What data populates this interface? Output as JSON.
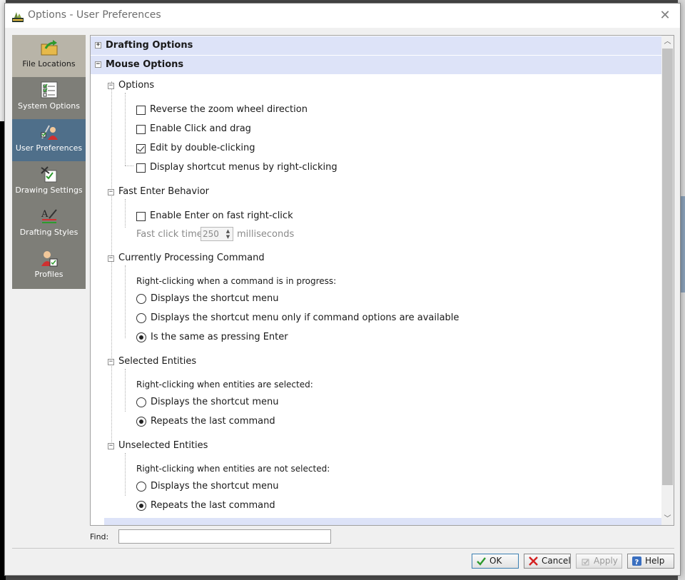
{
  "window": {
    "title": "Options - User Preferences",
    "close_glyph": "✕"
  },
  "nav": {
    "items": [
      {
        "label": "File Locations",
        "icon": "folder-arrow-icon"
      },
      {
        "label": "System Options",
        "icon": "checklist-icon"
      },
      {
        "label": "User Preferences",
        "icon": "user-preferences-icon"
      },
      {
        "label": "Drawing Settings",
        "icon": "drawing-settings-icon"
      },
      {
        "label": "Drafting Styles",
        "icon": "drafting-styles-icon"
      },
      {
        "label": "Profiles",
        "icon": "profiles-icon"
      }
    ],
    "selected": "User Preferences"
  },
  "tree": {
    "drafting": {
      "label": "Drafting Options",
      "expander": "+"
    },
    "mouse": {
      "label": "Mouse Options",
      "expander": "−"
    },
    "options": {
      "label": "Options",
      "expander": "−",
      "items": [
        {
          "label": "Reverse the zoom wheel direction",
          "checked": false
        },
        {
          "label": "Enable Click and drag",
          "checked": false
        },
        {
          "label": "Edit by double-clicking",
          "checked": true
        },
        {
          "label": "Display shortcut menus by right-clicking",
          "checked": false
        }
      ]
    },
    "fast_enter": {
      "label": "Fast Enter Behavior",
      "expander": "−",
      "enable_label": "Enable Enter on fast right-click",
      "enable_checked": false,
      "time_label": "Fast click time:",
      "time_value": "250",
      "time_unit": "milliseconds"
    },
    "processing": {
      "label": "Currently Processing Command",
      "expander": "−",
      "caption": "Right-clicking when a command is in progress:",
      "options": [
        {
          "label": "Displays the shortcut menu",
          "selected": false
        },
        {
          "label": "Displays the shortcut menu only if command options are available",
          "selected": false
        },
        {
          "label": "Is the same as pressing Enter",
          "selected": true
        }
      ]
    },
    "selected_entities": {
      "label": "Selected Entities",
      "expander": "−",
      "caption": "Right-clicking when entities are selected:",
      "options": [
        {
          "label": "Displays the shortcut menu",
          "selected": false
        },
        {
          "label": "Repeats the last command",
          "selected": true
        }
      ]
    },
    "unselected_entities": {
      "label": "Unselected Entities",
      "expander": "−",
      "caption": "Right-clicking when entities are not selected:",
      "options": [
        {
          "label": "Displays the shortcut menu",
          "selected": false
        },
        {
          "label": "Repeats the last command",
          "selected": true
        }
      ]
    }
  },
  "find": {
    "label": "Find:",
    "value": "",
    "placeholder": ""
  },
  "buttons": {
    "ok": "OK",
    "cancel": "Cancel",
    "apply": "Apply",
    "help": "Help"
  },
  "colors": {
    "section_header_bg": "#dde3f8",
    "nav_bg": "#7e7e78",
    "nav_selected_bg": "#4f6f8a",
    "ok_check": "#2e9a2e",
    "cancel_x": "#d42020",
    "help_blue": "#3a6fc0"
  }
}
